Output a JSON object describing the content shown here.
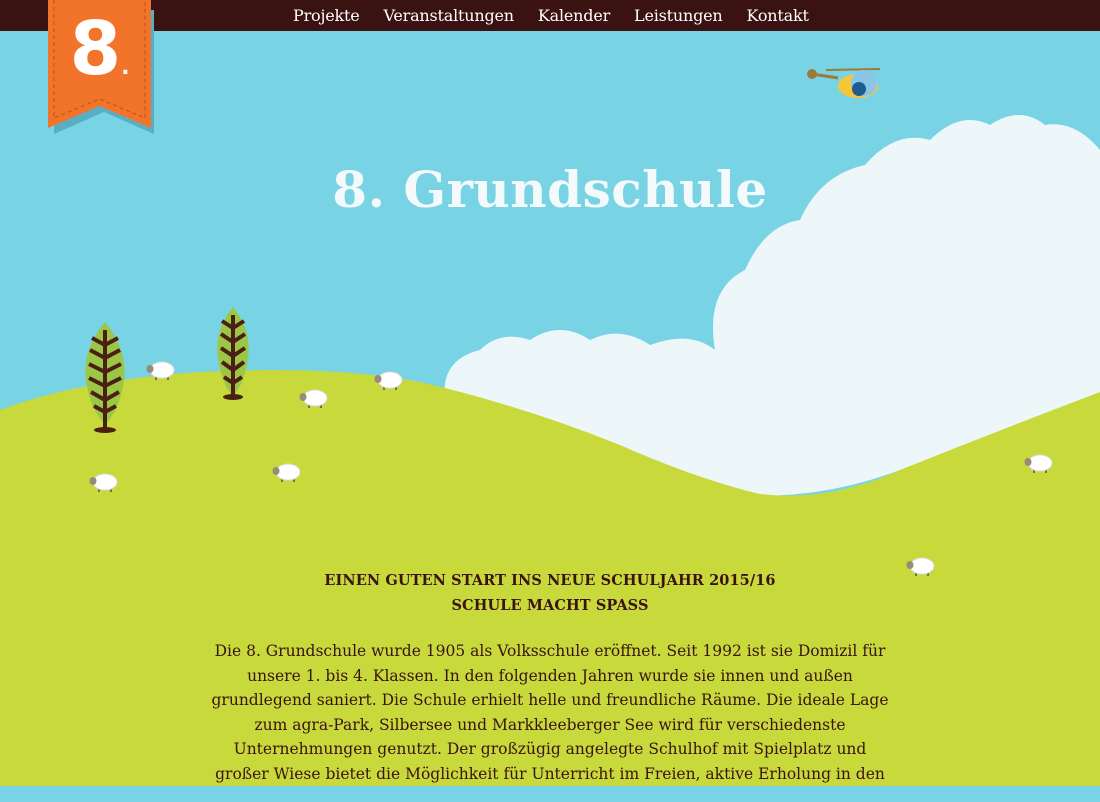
{
  "brand": {
    "logo_number": "8",
    "logo_dot": ".",
    "ribbon_color": "#f2742a",
    "ribbon_shadow": "#5aaec4"
  },
  "nav": {
    "items": [
      "Projekte",
      "Veranstaltungen",
      "Kalender",
      "Leistungen",
      "Kontakt"
    ]
  },
  "hero": {
    "title": "8. Grundschule"
  },
  "content": {
    "headline1": "EINEN GUTEN START INS NEUE SCHULJAHR 2015/16",
    "headline2": "SCHULE MACHT SPASS",
    "intro_lines": [
      "Die 8. Grundschule wurde 1905 als Volksschule eröffnet. Seit 1992 ist sie Domizil für",
      "unsere 1. bis 4. Klassen. In den folgenden Jahren wurde sie innen und außen",
      "grundlegend saniert. Die Schule erhielt helle und freundliche Räume. Die ideale Lage",
      "zum agra-Park, Silbersee und Markkleeberger See wird für verschiedenste",
      "Unternehmungen genutzt. Der großzügig angelegte Schulhof mit Spielplatz und",
      "großer Wiese bietet die Möglichkeit für Unterricht im Freien, aktive Erholung in den"
    ]
  },
  "colors": {
    "nav_bg": "#3a1212",
    "sky": "#78d4e4",
    "cloud": "#edf7f9",
    "grass": "#c8d93c",
    "text": "#3a1212",
    "tree_dark": "#4a1f14",
    "tree_light": "#9cc646"
  },
  "decor": [
    "helicopter-icon",
    "cloud",
    "tree-icon",
    "tree-icon",
    "sheep-icon"
  ]
}
